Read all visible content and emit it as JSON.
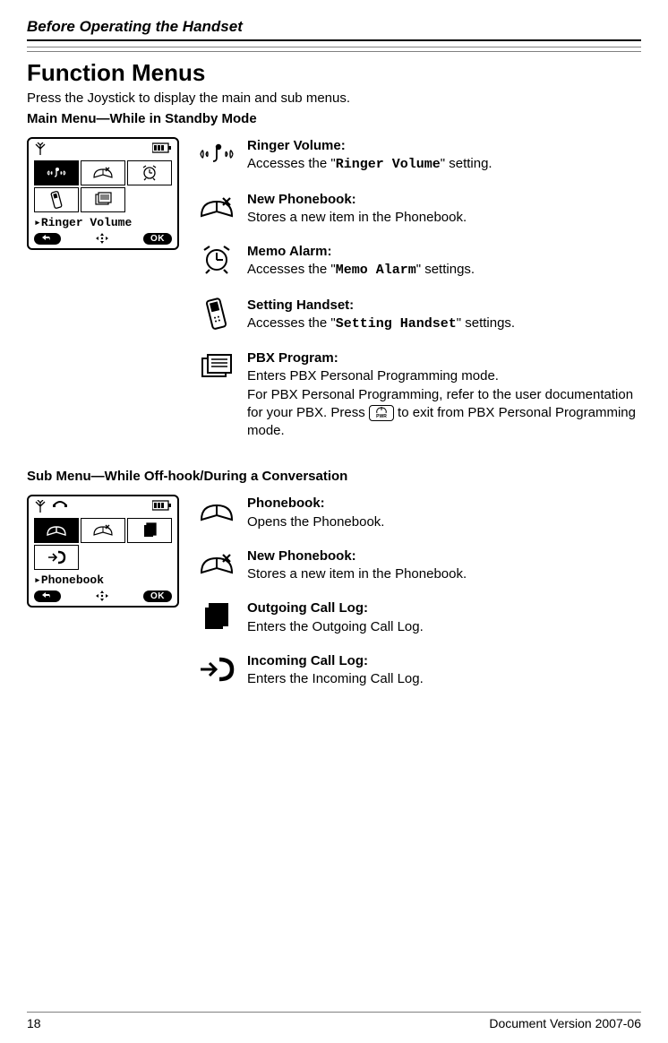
{
  "header": {
    "section": "Before Operating the Handset"
  },
  "title": "Function Menus",
  "intro": "Press the Joystick to display the main and sub menus.",
  "main_menu": {
    "heading": "Main Menu—While in Standby Mode",
    "screen_label": "Ringer Volume",
    "screen_softleft_alt": "back",
    "screen_softright": "OK",
    "items": [
      {
        "label": "Ringer Volume:",
        "pre": "Accesses the \"",
        "code": "Ringer Volume",
        "post_text": "\" setting."
      },
      {
        "label": "New Phonebook:",
        "desc": "Stores a new item in the Phonebook."
      },
      {
        "label": "Memo Alarm:",
        "pre": "Accesses the \"",
        "code": "Memo Alarm",
        "post_text": "\" settings."
      },
      {
        "label": "Setting Handset:",
        "pre": "Accesses the \"",
        "code": "Setting Handset",
        "post_text": "\" settings."
      },
      {
        "label": "PBX Program:",
        "line1": "Enters PBX Personal Programming mode.",
        "line2a": "For PBX Personal Programming, refer to the user documentation for your PBX. Press ",
        "line2b": " to exit from PBX Personal Programming mode."
      }
    ]
  },
  "sub_menu": {
    "heading": "Sub Menu—While Off-hook/During a Conversation",
    "screen_label": "Phonebook",
    "screen_softright": "OK",
    "items": [
      {
        "label": "Phonebook:",
        "desc": "Opens the Phonebook."
      },
      {
        "label": "New Phonebook:",
        "desc": "Stores a new item in the Phonebook."
      },
      {
        "label": "Outgoing Call Log:",
        "desc": "Enters the Outgoing Call Log."
      },
      {
        "label": "Incoming Call Log:",
        "desc": "Enters the Incoming Call Log."
      }
    ]
  },
  "footer": {
    "page": "18",
    "docver": "Document Version 2007-06"
  }
}
